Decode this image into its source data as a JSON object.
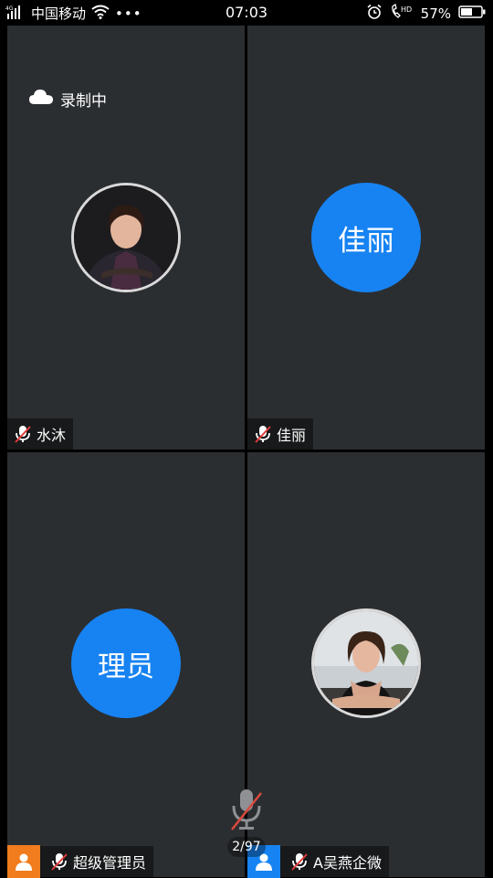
{
  "status_bar": {
    "network": "4G",
    "carrier": "中国移动",
    "time": "07:03",
    "battery": "57%",
    "volte": "HD"
  },
  "recording": {
    "label": "录制中"
  },
  "participants": [
    {
      "name": "水沐",
      "avatar_type": "photo",
      "muted": true
    },
    {
      "name": "佳丽",
      "avatar_text": "佳丽",
      "muted": true
    },
    {
      "name": "超级管理员",
      "avatar_text": "理员",
      "muted": true,
      "role_color": "#f07c1d"
    },
    {
      "name": "A吴燕企微",
      "avatar_type": "photo",
      "muted": true,
      "role_color": "#1783f2"
    }
  ],
  "pager": {
    "label": "2/97"
  },
  "colors": {
    "tile_bg": "#2b2e31",
    "avatar_blue": "#1783f2",
    "host_orange": "#f07c1d",
    "muted_red": "#e23b3b"
  }
}
